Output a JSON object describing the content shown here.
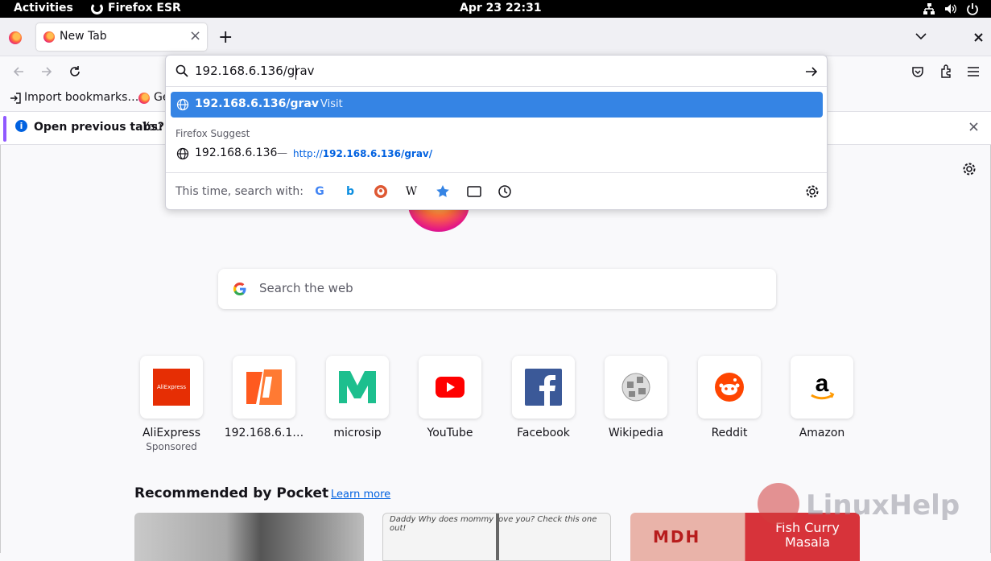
{
  "system_bar": {
    "activities": "Activities",
    "app_name": "Firefox ESR",
    "clock": "Apr 23  22:31"
  },
  "tabs": {
    "active_tab_title": "New Tab",
    "close_glyph": "×",
    "new_tab_glyph": "+"
  },
  "url_bar": {
    "value": "192.168.6.136/grav",
    "suggestion_primary": {
      "text": "192.168.6.136/grav",
      "action": "Visit"
    },
    "section_label": "Firefox Suggest",
    "suggestion_secondary": {
      "text": "192.168.6.136",
      "url": "http://192.168.6.136/grav/",
      "url_prefix": "http://",
      "url_bold": "192.168.6.136/grav/"
    },
    "search_with_label": "This time, search with:",
    "engines": [
      "google-icon",
      "bing-icon",
      "duckduckgo-icon",
      "wikipedia-icon",
      "bookmarks-icon",
      "tabs-icon",
      "history-icon"
    ]
  },
  "bookmarks": {
    "import": "Import bookmarks…",
    "getting_started_partial": "Ge"
  },
  "notification": {
    "bold": "Open previous tabs?",
    "rest": "You c"
  },
  "newtab": {
    "logo_partial": "Firefox",
    "search_placeholder": "Search the web",
    "top_sites": [
      {
        "label": "AliExpress",
        "sub": "Sponsored",
        "icon": "aliexpress-icon"
      },
      {
        "label": "192.168.6.1…",
        "sub": "",
        "icon": "ip-site-icon"
      },
      {
        "label": "microsip",
        "sub": "",
        "icon": "microsip-icon"
      },
      {
        "label": "YouTube",
        "sub": "",
        "icon": "youtube-icon"
      },
      {
        "label": "Facebook",
        "sub": "",
        "icon": "facebook-icon"
      },
      {
        "label": "Wikipedia",
        "sub": "",
        "icon": "wikipedia-globe-icon"
      },
      {
        "label": "Reddit",
        "sub": "",
        "icon": "reddit-icon"
      },
      {
        "label": "Amazon",
        "sub": "",
        "icon": "amazon-icon"
      }
    ],
    "aliexpress_logo_text": "AliExpress",
    "pocket_heading": "Recommended by Pocket",
    "learn_more": "Learn more",
    "card_fish_text": "Fish Curry Masala",
    "card_comic_text": "Daddy Why does mommy love you?  Check this one out!",
    "card_brand_text": "MDH"
  },
  "watermark": "LinuxHelp",
  "colors": {
    "accent": "#3584e4",
    "link": "#0061e0",
    "notice_bar": "#9059ff"
  }
}
